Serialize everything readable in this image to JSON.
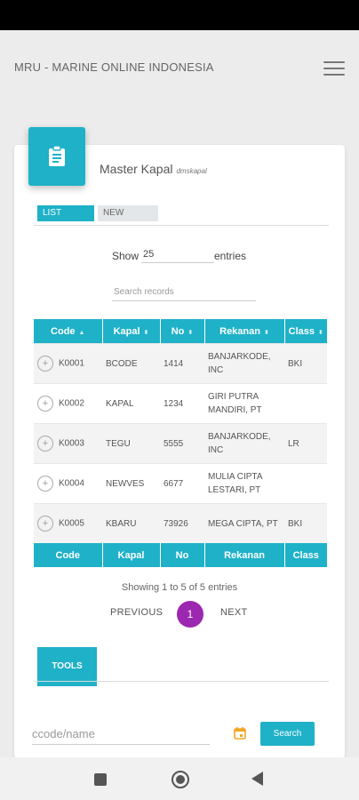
{
  "app": {
    "title": "MRU - MARINE ONLINE INDONESIA"
  },
  "card": {
    "title": "Master Kapal",
    "subtitle": "dmskapal",
    "tabs": [
      {
        "label": "LIST",
        "active": true
      },
      {
        "label": "NEW",
        "active": false
      }
    ]
  },
  "list": {
    "show_label": "Show",
    "entries_value": "25",
    "entries_label": "entries",
    "search_placeholder": "Search records",
    "columns": [
      "Code",
      "Kapal",
      "No",
      "Rekanan",
      "Class"
    ],
    "rows": [
      {
        "code": "K0001",
        "kapal": "BCODE",
        "no": "1414",
        "rekanan": "BANJARKODE, INC",
        "class": "BKI"
      },
      {
        "code": "K0002",
        "kapal": "KAPAL",
        "no": "1234",
        "rekanan": "GIRI PUTRA MANDIRI, PT",
        "class": ""
      },
      {
        "code": "K0003",
        "kapal": "TEGU",
        "no": "5555",
        "rekanan": "BANJARKODE, INC",
        "class": "LR"
      },
      {
        "code": "K0004",
        "kapal": "NEWVES",
        "no": "6677",
        "rekanan": "MULIA CIPTA LESTARI, PT",
        "class": ""
      },
      {
        "code": "K0005",
        "kapal": "KBARU",
        "no": "73926",
        "rekanan": "MEGA CIPTA, PT",
        "class": "BKI"
      }
    ],
    "info": "Showing 1 to 5 of 5 entries",
    "pagination": {
      "previous": "PREVIOUS",
      "current": "1",
      "next": "NEXT"
    }
  },
  "tools": {
    "tab_label": "TOOLS",
    "input_placeholder": "ccode/name",
    "search_label": "Search"
  },
  "colors": {
    "accent": "#1fb1c7",
    "page_active": "#9c27b0",
    "calendar": "#f5a623"
  }
}
